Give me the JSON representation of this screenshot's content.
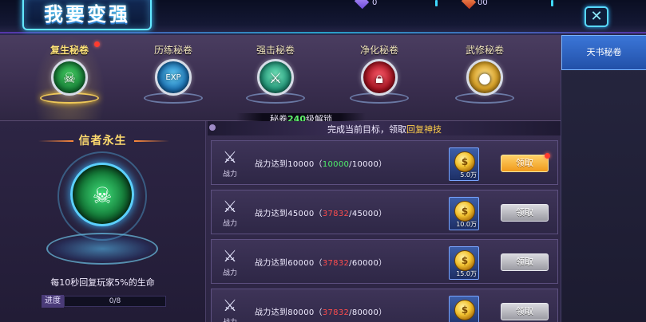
{
  "header": {
    "title": "我要变强",
    "currencies": [
      {
        "icon": "purple-gem-icon",
        "value": "0"
      },
      {
        "icon": "orange-gem-icon",
        "value": "00"
      }
    ],
    "close_icon": "close-icon"
  },
  "tabs": [
    {
      "label": "复生秘卷",
      "active": true,
      "badge": true,
      "icon": "green-skull-orb-icon"
    },
    {
      "label": "历练秘卷",
      "active": false,
      "badge": false,
      "icon": "exp-orb-icon"
    },
    {
      "label": "强击秘卷",
      "active": false,
      "badge": false,
      "icon": "sword-orb-icon"
    },
    {
      "label": "净化秘卷",
      "active": false,
      "badge": false,
      "icon": "lock-orb-icon"
    },
    {
      "label": "武修秘卷",
      "active": false,
      "badge": false,
      "icon": "golden-orb-icon"
    }
  ],
  "unlock": {
    "prefix": "秘卷",
    "level": "240",
    "suffix": "级解锁"
  },
  "hero": {
    "title": "信者永生",
    "description": "每10秒回复玩家5%的生命",
    "progress_label": "进度",
    "progress_text": "0/8",
    "progress_fraction": 0
  },
  "list_header": {
    "prefix": "完成当前目标，领取",
    "highlight": "回复神技"
  },
  "rows": [
    {
      "icon_label": "战力",
      "req_prefix": "战力达到",
      "target": "10000",
      "current": "10000",
      "current_ok": true,
      "reward_amount": "5.0万",
      "button": "领取",
      "button_state": "ready",
      "badge": true
    },
    {
      "icon_label": "战力",
      "req_prefix": "战力达到",
      "target": "45000",
      "current": "37832",
      "current_ok": false,
      "reward_amount": "10.0万",
      "button": "领取",
      "button_state": "locked",
      "badge": false
    },
    {
      "icon_label": "战力",
      "req_prefix": "战力达到",
      "target": "60000",
      "current": "37832",
      "current_ok": false,
      "reward_amount": "15.0万",
      "button": "领取",
      "button_state": "locked",
      "badge": false
    },
    {
      "icon_label": "战力",
      "req_prefix": "战力达到",
      "target": "80000",
      "current": "37832",
      "current_ok": false,
      "reward_amount": "",
      "button": "领取",
      "button_state": "locked",
      "badge": false
    }
  ],
  "sidebar": {
    "tabs": [
      {
        "label": "天书秘卷",
        "active": true
      }
    ]
  },
  "colors": {
    "accent": "#5bd0ff",
    "ok": "#4ef06a",
    "bad": "#ff4d4d",
    "highlight": "#ffcf4a",
    "ready_button": "#f09a1c"
  }
}
